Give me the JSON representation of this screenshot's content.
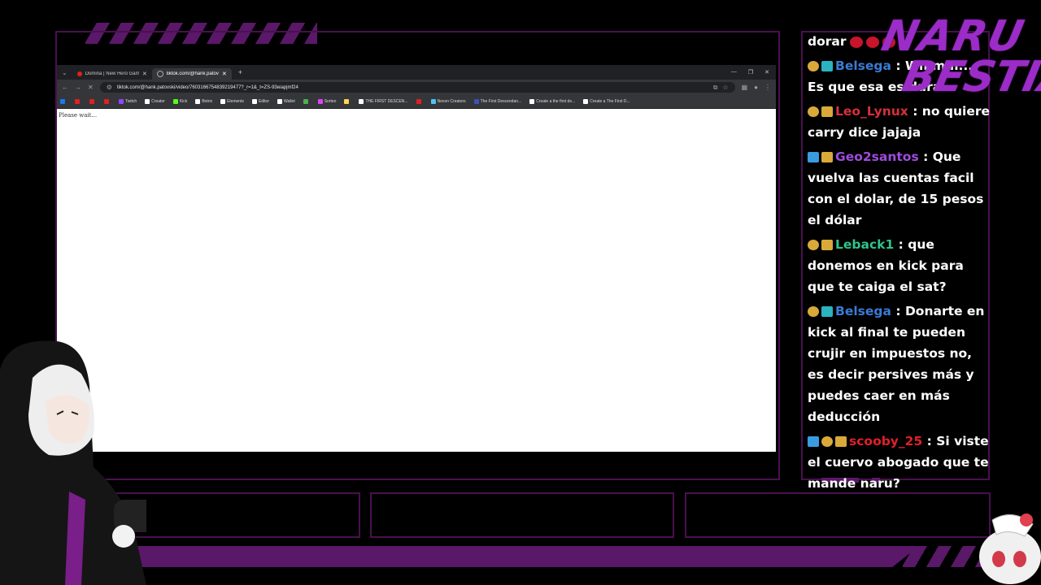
{
  "browser": {
    "tabs": [
      {
        "title": "Domina | New Hero Gameplay",
        "active": false,
        "favicon_color": "#e02020"
      },
      {
        "title": "tiktok.com/@hank.patovski/vid",
        "active": true,
        "favicon_color": "#aaaaaa"
      }
    ],
    "new_tab_label": "+",
    "url": "tiktok.com/@hank.patovski/video/7603166754839219477?_r=1&_t=ZS-93eiapjmf24",
    "bookmarks": [
      {
        "label": "",
        "color": "#1877f2"
      },
      {
        "label": "",
        "color": "#e02020"
      },
      {
        "label": "",
        "color": "#e02020"
      },
      {
        "label": "",
        "color": "#e02020"
      },
      {
        "label": "Twitch",
        "color": "#9146ff"
      },
      {
        "label": "Creator",
        "color": "#ffffff"
      },
      {
        "label": "Kick",
        "color": "#53fc18"
      },
      {
        "label": "Botrix",
        "color": "#ffffff"
      },
      {
        "label": "Elements",
        "color": "#ffffff"
      },
      {
        "label": "Editor",
        "color": "#ffffff"
      },
      {
        "label": "Wallet",
        "color": "#ffffff"
      },
      {
        "label": "",
        "color": "#4caf50"
      },
      {
        "label": "Sorteo",
        "color": "#e040fb"
      },
      {
        "label": "",
        "color": "#ffd54f"
      },
      {
        "label": "THE FIRST DESCEN...",
        "color": "#ffffff"
      },
      {
        "label": "",
        "color": "#e02020"
      },
      {
        "label": "Nexon Creators",
        "color": "#4fc3f7"
      },
      {
        "label": "The First Descendan...",
        "color": "#3f51b5"
      },
      {
        "label": "Create a the first de...",
        "color": "#ffffff"
      },
      {
        "label": "Create a The First D...",
        "color": "#ffffff"
      }
    ],
    "page_text": "Please wait..."
  },
  "chat": {
    "messages": [
      {
        "badges": [],
        "user": "",
        "user_color": "#ffffff",
        "text": "dorar",
        "emotes": 3
      },
      {
        "badges": [
          "emoji",
          "sub"
        ],
        "user": "Belsega",
        "user_color": "#3a7bd5",
        "text": ": Wmmm... Es que esa es dura",
        "emotes": 0
      },
      {
        "badges": [
          "emoji",
          "vip"
        ],
        "user": "Leo_Lynux",
        "user_color": "#d6303a",
        "text": ": no quiere carry dice jajaja",
        "emotes": 0
      },
      {
        "badges": [
          "mod",
          "vip"
        ],
        "user": "Geo2santos",
        "user_color": "#a04be0",
        "text": ": Que vuelva las cuentas facil con el dolar, de 15 pesos el dólar",
        "emotes": 0
      },
      {
        "badges": [
          "emoji",
          "vip"
        ],
        "user": "Leback1",
        "user_color": "#2fc48a",
        "text": ": que donemos en kick para que te caiga el sat?",
        "emotes": 0
      },
      {
        "badges": [
          "emoji",
          "sub"
        ],
        "user": "Belsega",
        "user_color": "#3a7bd5",
        "text": ": Donarte en kick al final te pueden crujir en impuestos no, es decir persives más y puedes caer en más deducción",
        "emotes": 0
      },
      {
        "badges": [
          "mod",
          "emoji",
          "vip"
        ],
        "user": "scooby_25",
        "user_color": "#e0202a",
        "text": ": Si viste el cuervo abogado que te mande naru?",
        "emotes": 0
      }
    ]
  },
  "logo": {
    "line1": "NARU",
    "line2": "BESTIA"
  }
}
